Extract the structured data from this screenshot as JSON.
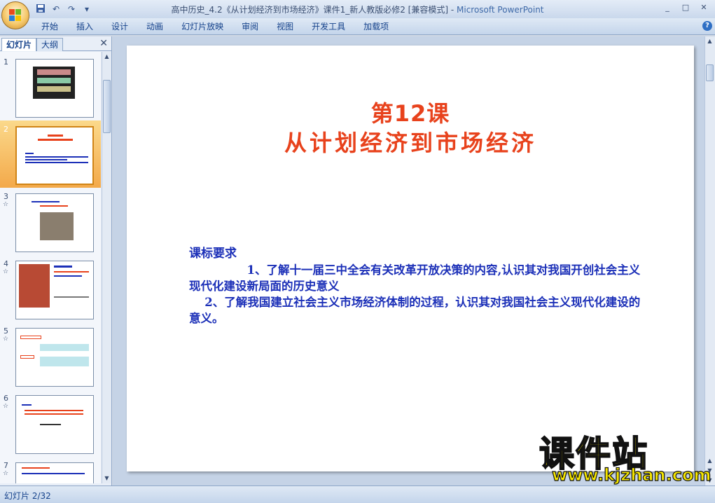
{
  "window": {
    "title_doc": "高中历史_4.2《从计划经济到市场经济》课件1_新人教版必修2 [兼容模式] - ",
    "title_app": "Microsoft PowerPoint",
    "controls": [
      "_",
      "□",
      "✕"
    ]
  },
  "quick_access": {
    "save_icon": "save-icon",
    "undo_label": "↶",
    "redo_label": "↷",
    "more_label": "▾"
  },
  "ribbon": {
    "tabs": [
      "开始",
      "插入",
      "设计",
      "动画",
      "幻灯片放映",
      "审阅",
      "视图",
      "开发工具",
      "加载项"
    ],
    "help_label": "?"
  },
  "panel": {
    "tab_slides": "幻灯片",
    "tab_outline": "大纲",
    "close_label": "✕",
    "thumbnails": [
      {
        "number": "1",
        "star": ""
      },
      {
        "number": "2",
        "star": ""
      },
      {
        "number": "3",
        "star": "☆"
      },
      {
        "number": "4",
        "star": "☆"
      },
      {
        "number": "5",
        "star": "☆"
      },
      {
        "number": "6",
        "star": "☆"
      },
      {
        "number": "7",
        "star": "☆"
      }
    ]
  },
  "slide": {
    "title_line1": "第12课",
    "title_line2": "从计划经济到市场经济",
    "req_heading": "课标要求",
    "req_item1": "　　　　　1、了解十一届三中全会有关改革开放决策的内容,认识其对我国开创社会主义现代化建设新局面的历史意义",
    "req_item2": "　 2、了解我国建立社会主义市场经济体制的过程，认识其对我国社会主义现代化建设的意义。"
  },
  "status": {
    "slide_counter": "幻灯片 2/32"
  },
  "watermark": {
    "brand": "课件站",
    "url": "www.kjzhan.com"
  },
  "colors": {
    "title_red": "#e8421c",
    "body_blue": "#1c30b8",
    "selected_orange": "#f3a94a"
  }
}
